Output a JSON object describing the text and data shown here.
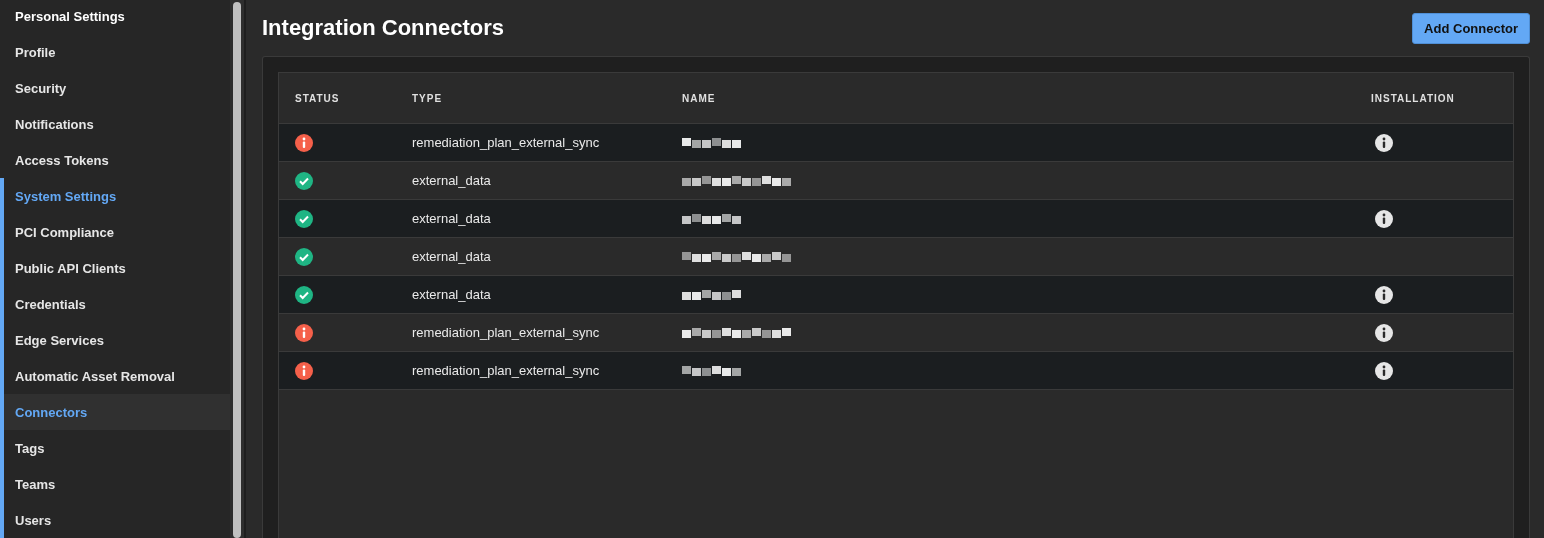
{
  "sidebar": {
    "sections": [
      {
        "title": "Personal Settings",
        "active": false,
        "items": [
          {
            "label": "Profile",
            "selected": false
          },
          {
            "label": "Security",
            "selected": false
          },
          {
            "label": "Notifications",
            "selected": false
          },
          {
            "label": "Access Tokens",
            "selected": false
          }
        ]
      },
      {
        "title": "System Settings",
        "active": true,
        "items": [
          {
            "label": "PCI Compliance",
            "selected": false
          },
          {
            "label": "Public API Clients",
            "selected": false
          },
          {
            "label": "Credentials",
            "selected": false
          },
          {
            "label": "Edge Services",
            "selected": false
          },
          {
            "label": "Automatic Asset Removal",
            "selected": false
          },
          {
            "label": "Connectors",
            "selected": true
          },
          {
            "label": "Tags",
            "selected": false
          },
          {
            "label": "Teams",
            "selected": false
          },
          {
            "label": "Users",
            "selected": false
          }
        ]
      }
    ]
  },
  "page": {
    "title": "Integration Connectors",
    "add_button": "Add Connector"
  },
  "table": {
    "columns": [
      "STATUS",
      "TYPE",
      "NAME",
      "INSTALLATION"
    ],
    "rows": [
      {
        "kind": "error",
        "type": "remediation_plan_external_sync",
        "installation_info": true
      },
      {
        "kind": "ok",
        "type": "external_data",
        "installation_info": false
      },
      {
        "kind": "ok",
        "type": "external_data",
        "installation_info": true
      },
      {
        "kind": "ok",
        "type": "external_data",
        "installation_info": false
      },
      {
        "kind": "ok",
        "type": "external_data",
        "installation_info": true
      },
      {
        "kind": "error",
        "type": "remediation_plan_external_sync",
        "installation_info": true
      },
      {
        "kind": "error",
        "type": "remediation_plan_external_sync",
        "installation_info": true
      }
    ]
  }
}
